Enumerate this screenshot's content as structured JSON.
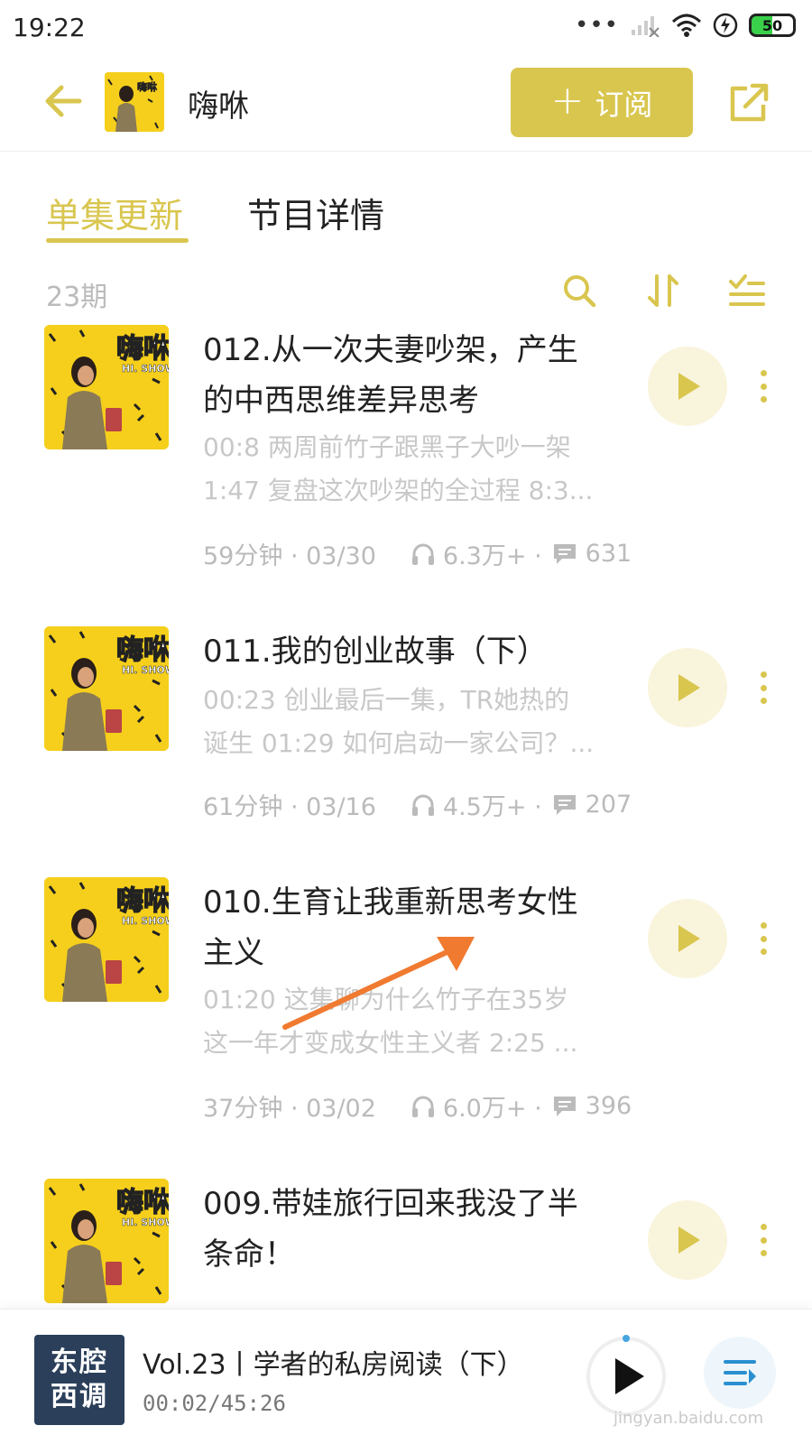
{
  "status_bar": {
    "time": "19:22",
    "battery": "50"
  },
  "header": {
    "title": "嗨咻",
    "subscribe_label": "订阅"
  },
  "tabs": [
    {
      "label": "单集更新",
      "active": true
    },
    {
      "label": "节目详情",
      "active": false
    }
  ],
  "list": {
    "count": "23期"
  },
  "episodes": [
    {
      "title_lines": [
        "012.从一次夫妻吵架，产生",
        "的中西思维差异思考"
      ],
      "desc_lines": [
        "00:8 两周前竹子跟黑子大吵一架",
        "1:47 复盘这次吵架的全过程 8:3..."
      ],
      "duration_date": "59分钟 · 03/30",
      "plays": "6.3万+ ·",
      "comments": "631"
    },
    {
      "title_lines": [
        "011.我的创业故事（下）"
      ],
      "desc_lines": [
        "00:23 创业最后一集，TR她热的",
        "诞生 01:29 如何启动一家公司？..."
      ],
      "duration_date": "61分钟 · 03/16",
      "plays": "4.5万+ ·",
      "comments": "207"
    },
    {
      "title_lines": [
        "010.生育让我重新思考女性",
        "主义"
      ],
      "desc_lines": [
        "01:20 这集聊为什么竹子在35岁",
        "这一年才变成女性主义者 2:25 ..."
      ],
      "duration_date": "37分钟 · 03/02",
      "plays": "6.0万+ ·",
      "comments": "396"
    },
    {
      "title_lines": [
        "009.带娃旅行回来我没了半",
        "条命！"
      ],
      "desc_lines": [],
      "duration_date": "",
      "plays": "",
      "comments": ""
    }
  ],
  "cover": {
    "title": "嗨咻",
    "subtitle": "HI. SHOW"
  },
  "player": {
    "cover_line1": "东腔",
    "cover_line2": "西调",
    "title": "Vol.23丨学者的私房阅读（下）",
    "time": "00:02/45:26"
  },
  "watermark": "jingyan.baidu.com",
  "colors": {
    "accent": "#d9c64f",
    "cover_yellow": "#f5cf1c",
    "muted_text": "#bbbbbb",
    "arrow": "#f07a30"
  },
  "icons": {
    "back": "arrow-left-icon",
    "share": "share-icon",
    "search": "search-icon",
    "sort": "sort-icon",
    "filter": "list-filter-icon",
    "play": "play-icon",
    "more": "more-vertical-icon",
    "headphones": "headphones-icon",
    "comment": "comment-icon",
    "playlist": "playlist-icon"
  }
}
